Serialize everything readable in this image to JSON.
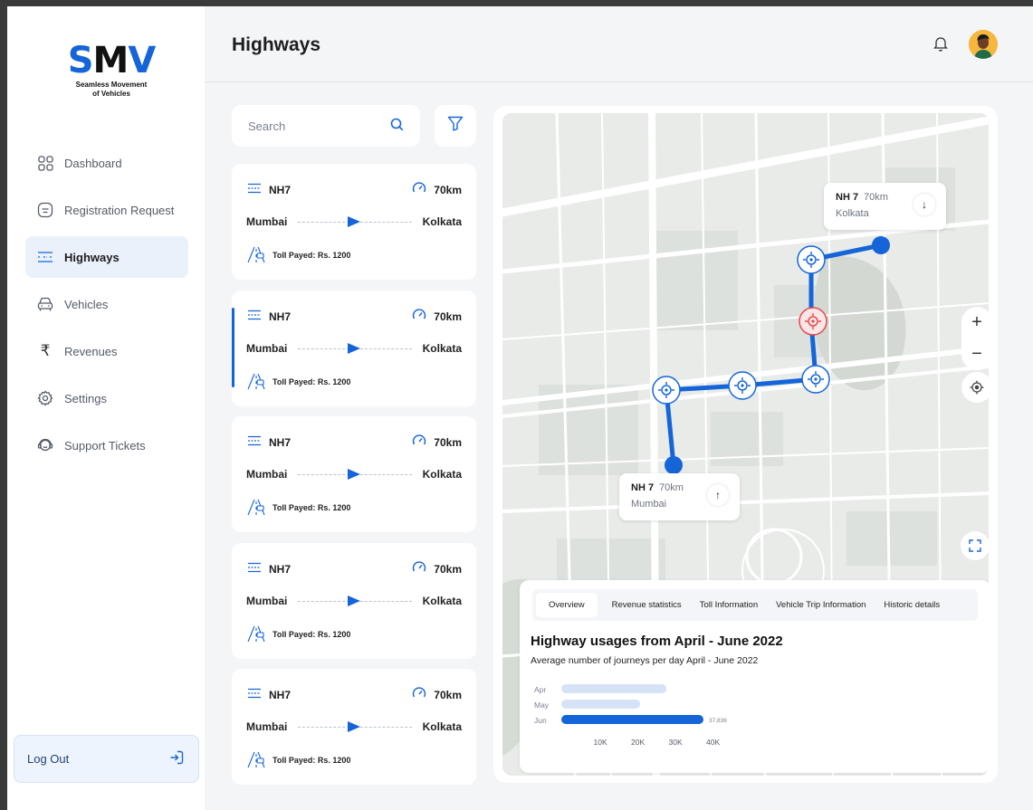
{
  "brand": {
    "mark_s": "S",
    "mark_m": "M",
    "mark_v": "V",
    "tagline_1": "Seamless Movement",
    "tagline_2": "of Vehicles",
    "accent": "#1565d8"
  },
  "sidebar": {
    "items": [
      {
        "label": "Dashboard",
        "icon": "grid-icon"
      },
      {
        "label": "Registration Request",
        "icon": "request-icon"
      },
      {
        "label": "Highways",
        "icon": "highway-icon",
        "active": true
      },
      {
        "label": "Vehicles",
        "icon": "car-icon"
      },
      {
        "label": "Revenues",
        "icon": "rupee-icon"
      },
      {
        "label": "Settings",
        "icon": "gear-icon"
      },
      {
        "label": "Support Tickets",
        "icon": "support-icon"
      }
    ],
    "logout_label": "Log Out"
  },
  "header": {
    "title": "Highways"
  },
  "search": {
    "placeholder": "Search"
  },
  "highways": [
    {
      "name": "NH7",
      "distance": "70km",
      "from": "Mumbai",
      "to": "Kolkata",
      "toll": "Toll Payed: Rs. 1200"
    },
    {
      "name": "NH7",
      "distance": "70km",
      "from": "Mumbai",
      "to": "Kolkata",
      "toll": "Toll Payed: Rs. 1200",
      "selected": true
    },
    {
      "name": "NH7",
      "distance": "70km",
      "from": "Mumbai",
      "to": "Kolkata",
      "toll": "Toll Payed: Rs. 1200"
    },
    {
      "name": "NH7",
      "distance": "70km",
      "from": "Mumbai",
      "to": "Kolkata",
      "toll": "Toll Payed: Rs. 1200"
    },
    {
      "name": "NH7",
      "distance": "70km",
      "from": "Mumbai",
      "to": "Kolkata",
      "toll": "Toll Payed: Rs. 1200"
    }
  ],
  "map": {
    "popup_end": {
      "name": "NH 7",
      "distance": "70km",
      "city": "Kolkata",
      "arrow": "↓"
    },
    "popup_start": {
      "name": "NH 7",
      "distance": "70km",
      "city": "Mumbai",
      "arrow": "↑"
    },
    "zoom_in": "+",
    "zoom_out": "−"
  },
  "stats": {
    "tabs": [
      "Overview",
      "Revenue statistics",
      "Toll Information",
      "Vehicle Trip Information",
      "Historic details"
    ],
    "title": "Highway usages from April - June 2022",
    "subtitle": "Average number of journeys per day  April - June 2022"
  },
  "chart_data": {
    "type": "bar",
    "orientation": "horizontal",
    "categories": [
      "Apr",
      "May",
      "Jun"
    ],
    "values": [
      28000,
      21000,
      37836
    ],
    "value_labels": [
      "",
      "",
      "37,836"
    ],
    "x_ticks": [
      "10K",
      "20K",
      "30K",
      "40K"
    ],
    "xlim": [
      0,
      40000
    ],
    "colors": {
      "highlight": "#1565d8",
      "muted": "#d6e3f7"
    }
  }
}
